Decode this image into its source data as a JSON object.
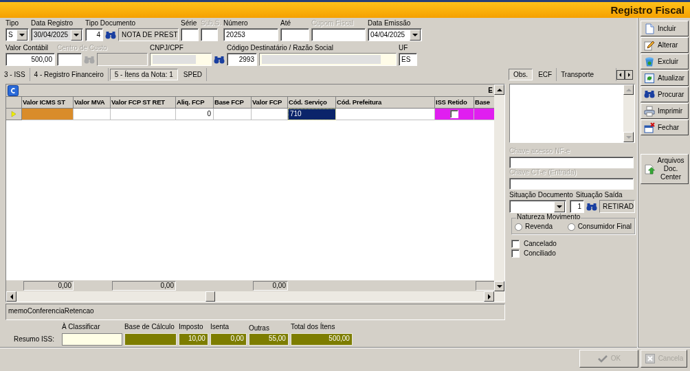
{
  "window": {
    "title": "Registro Fiscal"
  },
  "header_rows": [
    [
      {
        "label": "Tipo",
        "disabled": false,
        "controls": [
          {
            "kind": "combo",
            "value": "S"
          }
        ]
      },
      {
        "label": "Data Registro",
        "disabled": false,
        "controls": [
          {
            "kind": "combo-gray",
            "value": "30/04/2025"
          }
        ]
      },
      {
        "label": "Tipo Documento",
        "disabled": false,
        "controls": [
          {
            "kind": "number",
            "value": "4"
          },
          {
            "kind": "search"
          },
          {
            "kind": "readonly",
            "value": "NOTA DE PREST"
          }
        ]
      },
      {
        "label": "Série",
        "disabled": false,
        "controls": [
          {
            "kind": "text"
          }
        ]
      },
      {
        "label": "Sub.S.",
        "disabled": true,
        "controls": [
          {
            "kind": "text"
          }
        ]
      },
      {
        "label": "Número",
        "disabled": false,
        "controls": [
          {
            "kind": "text",
            "value": "20253"
          }
        ]
      },
      {
        "label": "Até",
        "disabled": false,
        "controls": [
          {
            "kind": "text"
          }
        ]
      },
      {
        "label": "Cupom Fiscal",
        "disabled": true,
        "controls": [
          {
            "kind": "text"
          }
        ]
      },
      {
        "label": "Data Emissão",
        "disabled": false,
        "controls": [
          {
            "kind": "combo",
            "value": "04/04/2025"
          }
        ]
      }
    ],
    [
      {
        "label": "Valor Contábil",
        "disabled": false,
        "controls": [
          {
            "kind": "number",
            "value": "500,00"
          }
        ]
      },
      {
        "label": "Centro de Custo",
        "disabled": true,
        "controls": [
          {
            "kind": "text"
          },
          {
            "kind": "search-disabled"
          },
          {
            "kind": "readonly"
          }
        ]
      },
      {
        "label": "CNPJ/CPF",
        "disabled": false,
        "controls": [
          {
            "kind": "cream"
          },
          {
            "kind": "search"
          }
        ]
      },
      {
        "label": "Código Destinatário / Razão Social",
        "disabled": false,
        "controls": [
          {
            "kind": "number",
            "value": "2993"
          },
          {
            "kind": "cream"
          }
        ]
      },
      {
        "label": "UF",
        "disabled": false,
        "controls": [
          {
            "kind": "text",
            "value": "ES"
          }
        ]
      }
    ]
  ],
  "tabs": [
    {
      "label": "3 - ISS",
      "selected": false
    },
    {
      "label": "4 - Registro Financeiro",
      "selected": false
    },
    {
      "label": "5 - Ítens da Nota: 1",
      "selected": true
    },
    {
      "label": "SPED",
      "selected": false
    }
  ],
  "grid": {
    "band_text": "E",
    "columns": [
      "Valor ICMS ST",
      "Valor MVA",
      "Valor FCP ST RET",
      "Aliq. FCP",
      "Base FCP",
      "Valor FCP",
      "Cód. Serviço",
      "Cód. Prefeitura",
      "ISS Retido",
      "Base"
    ],
    "rows": [
      {
        "selected": true,
        "cells": [
          {
            "kind": "number",
            "color": "#d98c2a",
            "selected": false
          },
          {
            "kind": "number",
            "selected": false
          },
          {
            "kind": "number",
            "selected": false
          },
          {
            "kind": "number",
            "value": "0",
            "selected": false
          },
          {
            "kind": "number",
            "selected": false
          },
          {
            "kind": "number",
            "selected": false
          },
          {
            "kind": "text",
            "value": "710",
            "selected": true
          },
          {
            "kind": "text",
            "selected": false
          },
          {
            "kind": "checkbox",
            "checked": false,
            "color": "#e01ef0",
            "selected": false
          },
          {
            "kind": "number",
            "color": "#e01ef0",
            "selected": false
          }
        ]
      }
    ],
    "footer": [
      {
        "kind": "total",
        "value": "0,00"
      },
      {
        "kind": "none"
      },
      {
        "kind": "total",
        "value": "0,00"
      },
      {
        "kind": "none"
      },
      {
        "kind": "none"
      },
      {
        "kind": "total",
        "value": "0,00"
      },
      {
        "kind": "none"
      },
      {
        "kind": "none"
      },
      {
        "kind": "none"
      },
      {
        "kind": "total"
      }
    ]
  },
  "memo_label": "memoConferenciaRetencao",
  "summary": {
    "label": "Resumo ISS:",
    "fields": [
      {
        "label": "À Classificar",
        "kind": "cream"
      },
      {
        "label": "Base de Cálculo",
        "kind": "olive"
      },
      {
        "label": "Imposto",
        "kind": "olive",
        "value": "10,00"
      },
      {
        "label": "Isenta",
        "kind": "olive",
        "value": "0,00"
      },
      {
        "label": "Outras",
        "kind": "olive",
        "value": "55,00"
      },
      {
        "label": "Total dos Ítens",
        "kind": "olive",
        "value": "500,00"
      }
    ]
  },
  "side_tabs": [
    {
      "label": "Obs.",
      "selected": true
    },
    {
      "label": "ECF",
      "selected": false
    },
    {
      "label": "Transporte",
      "selected": false
    }
  ],
  "side": {
    "fields": [
      {
        "label": "Chave acesso NF-e",
        "disabled": true
      },
      {
        "label": "Chave CT-e (Entrada)",
        "disabled": true
      }
    ],
    "situacao_documento": {
      "label": "Situação Documento"
    },
    "situacao_saida": {
      "label": "Situação Saída",
      "code": "1",
      "description": "RETIRAD"
    },
    "natureza": {
      "label": "Natureza Movimento",
      "options": [
        {
          "label": "Revenda",
          "selected": false
        },
        {
          "label": "Consumidor Final",
          "selected": false
        }
      ]
    },
    "checks": [
      {
        "label": "Cancelado",
        "checked": false
      },
      {
        "label": "Conciliado",
        "checked": false
      }
    ]
  },
  "toolbar": [
    {
      "label": "Incluir",
      "kind": "document",
      "disabled": false
    },
    {
      "label": "Alterar",
      "kind": "pencil",
      "disabled": false
    },
    {
      "label": "Excluir",
      "kind": "bin",
      "disabled": false
    },
    {
      "label": "Atualizar",
      "kind": "refresh",
      "disabled": false
    },
    {
      "label": "Procurar",
      "kind": "binoculars",
      "disabled": false
    },
    {
      "label": "Imprimir",
      "kind": "printer",
      "disabled": false
    },
    {
      "label": "Fechar",
      "kind": "close",
      "disabled": false
    }
  ],
  "side_button": {
    "label": "Arquivos Doc. Center",
    "kind": "upload"
  },
  "footer_buttons": [
    {
      "label": "OK",
      "kind": "check",
      "disabled": true
    },
    {
      "label": "Cancela",
      "kind": "cancel",
      "disabled": true
    }
  ]
}
